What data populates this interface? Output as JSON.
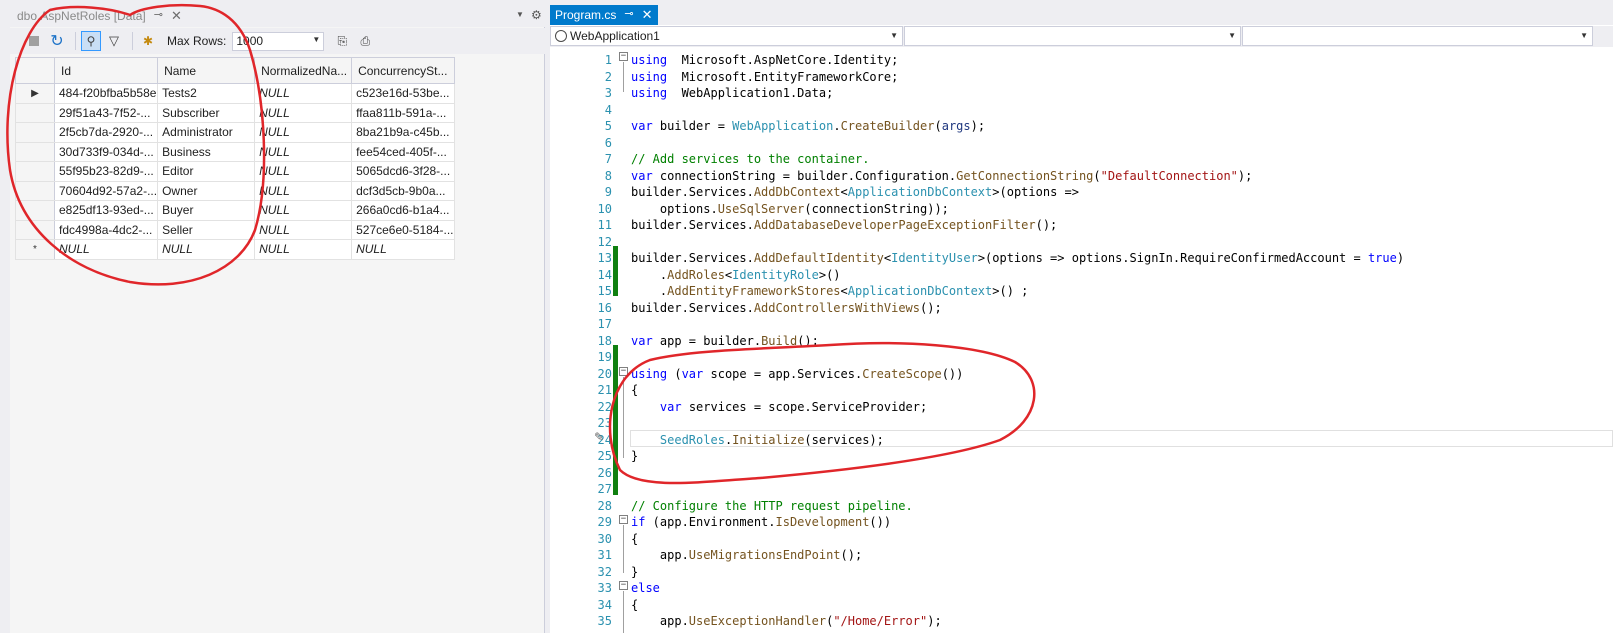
{
  "left_panel": {
    "tab_title": "dbo.AspNetRoles [Data]",
    "tab_pin": "⊸",
    "tab_close": "✕",
    "toolbar": {
      "max_rows_label": "Max Rows:",
      "max_rows_value": "1000"
    },
    "grid": {
      "columns": [
        "Id",
        "Name",
        "NormalizedNa...",
        "ConcurrencySt..."
      ],
      "rows": [
        {
          "indicator": "▶",
          "id": "484-f20bfba5b58e",
          "name": "Tests2",
          "normalized": "NULL",
          "concurrency": "c523e16d-53be..."
        },
        {
          "indicator": "",
          "id": "29f51a43-7f52-...",
          "name": "Subscriber",
          "normalized": "NULL",
          "concurrency": "ffaa811b-591a-..."
        },
        {
          "indicator": "",
          "id": "2f5cb7da-2920-...",
          "name": "Administrator",
          "normalized": "NULL",
          "concurrency": "8ba21b9a-c45b..."
        },
        {
          "indicator": "",
          "id": "30d733f9-034d-...",
          "name": "Business",
          "normalized": "NULL",
          "concurrency": "fee54ced-405f-..."
        },
        {
          "indicator": "",
          "id": "55f95b23-82d9-...",
          "name": "Editor",
          "normalized": "NULL",
          "concurrency": "5065dcd6-3f28-..."
        },
        {
          "indicator": "",
          "id": "70604d92-57a2-...",
          "name": "Owner",
          "normalized": "NULL",
          "concurrency": "dcf3d5cb-9b0a..."
        },
        {
          "indicator": "",
          "id": "e825df13-93ed-...",
          "name": "Buyer",
          "normalized": "NULL",
          "concurrency": "266a0cd6-b1a4..."
        },
        {
          "indicator": "",
          "id": "fdc4998a-4dc2-...",
          "name": "Seller",
          "normalized": "NULL",
          "concurrency": "527ce6e0-5184-..."
        },
        {
          "indicator": "*",
          "id": "NULL",
          "name": "NULL",
          "normalized": "NULL",
          "concurrency": "NULL"
        }
      ]
    }
  },
  "right_panel": {
    "tab_title": "Program.cs",
    "tab_pin": "⊸",
    "tab_close": "✕",
    "nav": {
      "project": "WebApplication1",
      "member": "",
      "scope": ""
    },
    "code_lines": [
      {
        "n": "1",
        "tokens": [
          [
            "kw",
            "using"
          ],
          [
            "",
            "  Microsoft.AspNetCore.Identity;"
          ]
        ]
      },
      {
        "n": "2",
        "tokens": [
          [
            "kw",
            "using"
          ],
          [
            "",
            "  Microsoft.EntityFrameworkCore;"
          ]
        ]
      },
      {
        "n": "3",
        "tokens": [
          [
            "kw",
            "using"
          ],
          [
            "",
            "  WebApplication1.Data;"
          ]
        ]
      },
      {
        "n": "4",
        "tokens": []
      },
      {
        "n": "5",
        "tokens": [
          [
            "kw",
            "var"
          ],
          [
            "",
            " builder = "
          ],
          [
            "ty",
            "WebApplication"
          ],
          [
            "",
            "."
          ],
          [
            "mt",
            "CreateBuilder"
          ],
          [
            "",
            "("
          ],
          [
            "pa",
            "args"
          ],
          [
            "",
            ");"
          ]
        ]
      },
      {
        "n": "6",
        "tokens": []
      },
      {
        "n": "7",
        "tokens": [
          [
            "cm",
            "// Add services to the container."
          ]
        ]
      },
      {
        "n": "8",
        "tokens": [
          [
            "kw",
            "var"
          ],
          [
            "",
            " connectionString = builder.Configuration."
          ],
          [
            "mt",
            "GetConnectionString"
          ],
          [
            "",
            "("
          ],
          [
            "st",
            "\"DefaultConnection\""
          ],
          [
            "",
            ");"
          ]
        ]
      },
      {
        "n": "9",
        "tokens": [
          [
            "",
            "builder.Services."
          ],
          [
            "mt",
            "AddDbContext"
          ],
          [
            "",
            "<"
          ],
          [
            "ty",
            "ApplicationDbContext"
          ],
          [
            "",
            ">(options =>"
          ]
        ]
      },
      {
        "n": "10",
        "tokens": [
          [
            "",
            "    options."
          ],
          [
            "mt",
            "UseSqlServer"
          ],
          [
            "",
            "(connectionString));"
          ]
        ]
      },
      {
        "n": "11",
        "tokens": [
          [
            "",
            "builder.Services."
          ],
          [
            "mt",
            "AddDatabaseDeveloperPageExceptionFilter"
          ],
          [
            "",
            "();"
          ]
        ]
      },
      {
        "n": "12",
        "tokens": []
      },
      {
        "n": "13",
        "tokens": [
          [
            "",
            "builder.Services."
          ],
          [
            "mt",
            "AddDefaultIdentity"
          ],
          [
            "",
            "<"
          ],
          [
            "ty",
            "IdentityUser"
          ],
          [
            "",
            ">(options => options.SignIn.RequireConfirmedAccount = "
          ],
          [
            "kw",
            "true"
          ],
          [
            "",
            ")"
          ]
        ]
      },
      {
        "n": "14",
        "tokens": [
          [
            "",
            "    ."
          ],
          [
            "mt",
            "AddRoles"
          ],
          [
            "",
            "<"
          ],
          [
            "ty",
            "IdentityRole"
          ],
          [
            "",
            ">()"
          ]
        ]
      },
      {
        "n": "15",
        "tokens": [
          [
            "",
            "    ."
          ],
          [
            "mt",
            "AddEntityFrameworkStores"
          ],
          [
            "",
            "<"
          ],
          [
            "ty",
            "ApplicationDbContext"
          ],
          [
            "",
            ">() ;"
          ]
        ]
      },
      {
        "n": "16",
        "tokens": [
          [
            "",
            "builder.Services."
          ],
          [
            "mt",
            "AddControllersWithViews"
          ],
          [
            "",
            "();"
          ]
        ]
      },
      {
        "n": "17",
        "tokens": []
      },
      {
        "n": "18",
        "tokens": [
          [
            "kw",
            "var"
          ],
          [
            "",
            " app = builder."
          ],
          [
            "mt",
            "Build"
          ],
          [
            "",
            "();"
          ]
        ]
      },
      {
        "n": "19",
        "tokens": []
      },
      {
        "n": "20",
        "tokens": [
          [
            "kw",
            "using"
          ],
          [
            "",
            " ("
          ],
          [
            "kw",
            "var"
          ],
          [
            "",
            " scope = app.Services."
          ],
          [
            "mt",
            "CreateScope"
          ],
          [
            "",
            "())"
          ]
        ]
      },
      {
        "n": "21",
        "tokens": [
          [
            "",
            "{"
          ]
        ]
      },
      {
        "n": "22",
        "tokens": [
          [
            "",
            "    "
          ],
          [
            "kw",
            "var"
          ],
          [
            "",
            " services = scope.ServiceProvider;"
          ]
        ]
      },
      {
        "n": "23",
        "tokens": []
      },
      {
        "n": "24",
        "tokens": [
          [
            "",
            "    "
          ],
          [
            "ty",
            "SeedRoles"
          ],
          [
            "",
            "."
          ],
          [
            "mt",
            "Initialize"
          ],
          [
            "",
            "(services);"
          ]
        ]
      },
      {
        "n": "25",
        "tokens": [
          [
            "",
            "}"
          ]
        ]
      },
      {
        "n": "26",
        "tokens": []
      },
      {
        "n": "27",
        "tokens": []
      },
      {
        "n": "28",
        "tokens": [
          [
            "cm",
            "// Configure the HTTP request pipeline."
          ]
        ]
      },
      {
        "n": "29",
        "tokens": [
          [
            "kw",
            "if"
          ],
          [
            "",
            " (app.Environment."
          ],
          [
            "mt",
            "IsDevelopment"
          ],
          [
            "",
            "())"
          ]
        ]
      },
      {
        "n": "30",
        "tokens": [
          [
            "",
            "{"
          ]
        ]
      },
      {
        "n": "31",
        "tokens": [
          [
            "",
            "    app."
          ],
          [
            "mt",
            "UseMigrationsEndPoint"
          ],
          [
            "",
            "();"
          ]
        ]
      },
      {
        "n": "32",
        "tokens": [
          [
            "",
            "}"
          ]
        ]
      },
      {
        "n": "33",
        "tokens": [
          [
            "kw",
            "else"
          ]
        ]
      },
      {
        "n": "34",
        "tokens": [
          [
            "",
            "{"
          ]
        ]
      },
      {
        "n": "35",
        "tokens": [
          [
            "",
            "    app."
          ],
          [
            "mt",
            "UseExceptionHandler"
          ],
          [
            "",
            "("
          ],
          [
            "st",
            "\"/Home/Error\""
          ],
          [
            "",
            ");"
          ]
        ]
      }
    ]
  },
  "colors": {
    "accent_tab": "#007acc",
    "line_numbers": "#2b91af",
    "keyword": "#0000ff",
    "type": "#2b91af",
    "string": "#a31515",
    "comment": "#008000",
    "change_bar": "#108010",
    "annotation": "#e0262a"
  }
}
